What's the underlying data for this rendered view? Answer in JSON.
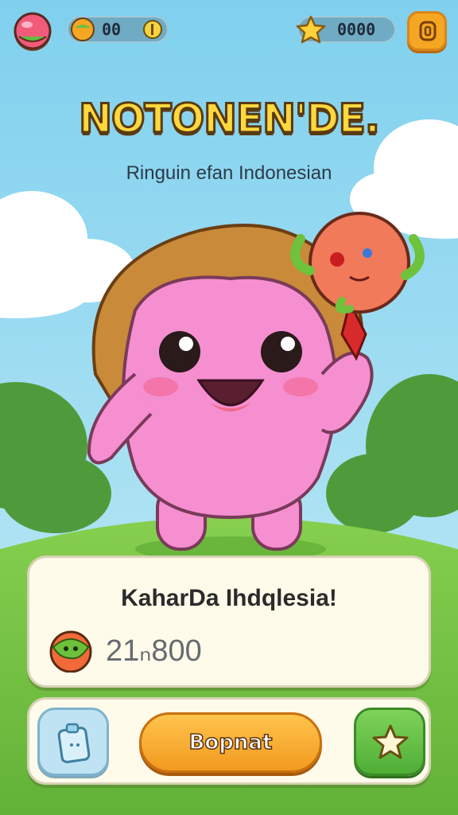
{
  "colors": {
    "sky": "#8fd6ee",
    "grass": "#7cc84a",
    "character_pink": "#f58fd0",
    "hair_brown": "#c98a3a",
    "accent_orange": "#f5a623",
    "accent_green": "#5fbf3f"
  },
  "hud": {
    "avatar_icon": "fruit-avatar-icon",
    "food_counter": {
      "icon": "bowl-icon",
      "value": "00"
    },
    "star_counter": {
      "icon": "star-icon",
      "value": "0000"
    },
    "menu_icon": "menu-icon"
  },
  "title": {
    "logo": "NOTONEN'DE.",
    "subtitle": "Ringuin efan Indonesian"
  },
  "character": {
    "icon": "pink-blob-character",
    "held_item_icon": "veggie-balloon-icon"
  },
  "card": {
    "heading": "KaharDa Ihdqlesia!",
    "currency_icon": "green-fruit-icon",
    "amount": "21ₙ800"
  },
  "actions": {
    "left_icon": "inventory-icon",
    "primary_label": "Bopnat",
    "right_icon": "star-icon"
  }
}
